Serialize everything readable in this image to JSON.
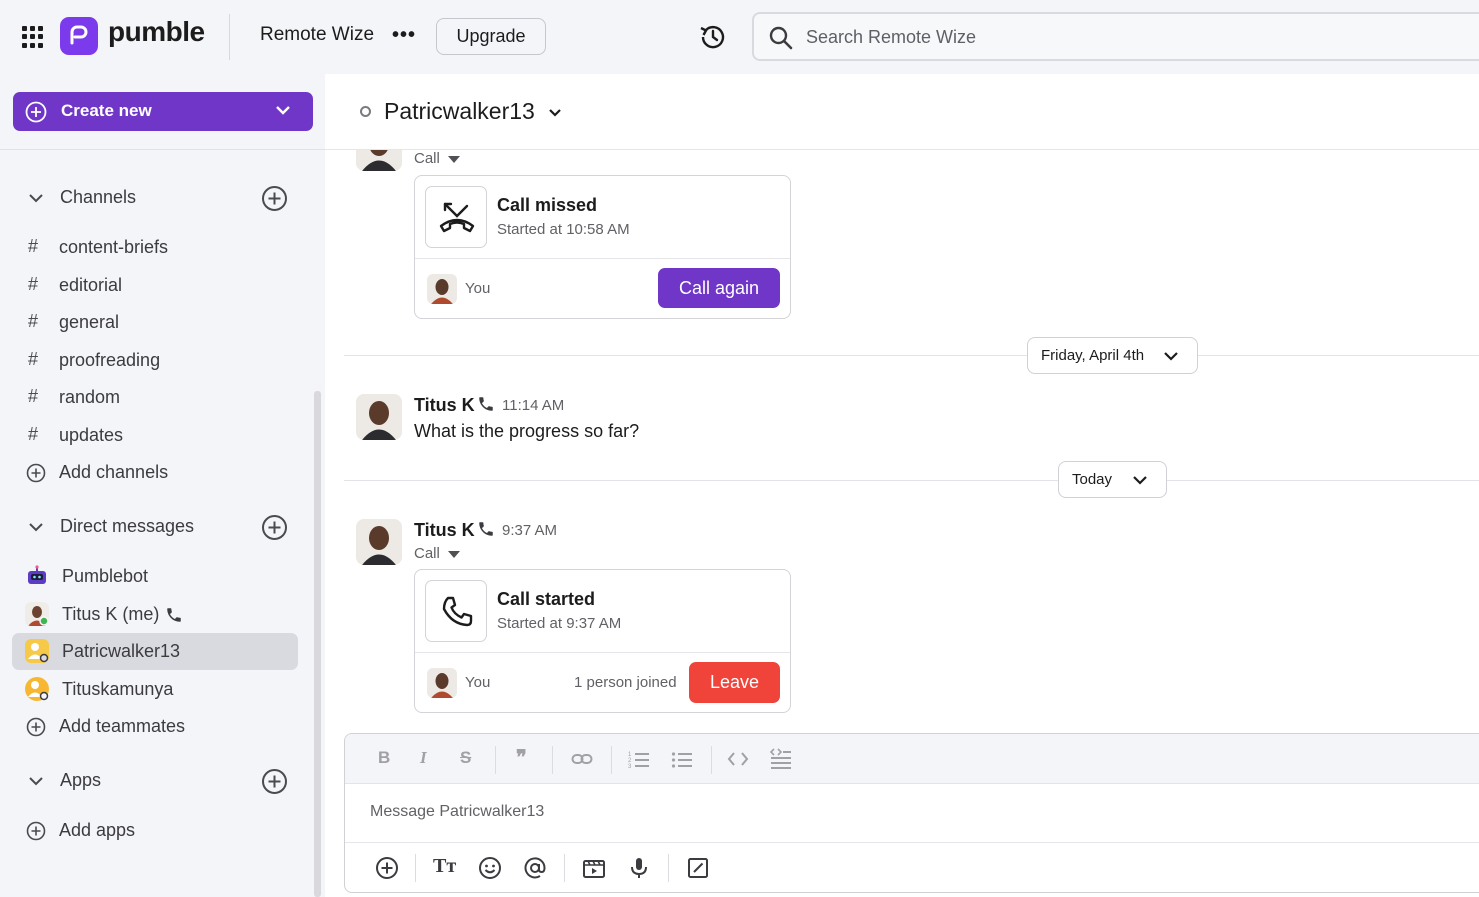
{
  "app": {
    "name": "pumble",
    "workspace": "Remote Wize",
    "upgrade_label": "Upgrade"
  },
  "search": {
    "placeholder": "Search Remote Wize"
  },
  "sidebar": {
    "create_new_label": "Create new",
    "channels_label": "Channels",
    "channels": [
      "content-briefs",
      "editorial",
      "general",
      "proofreading",
      "random",
      "updates"
    ],
    "add_channels_label": "Add channels",
    "dm_label": "Direct messages",
    "dms": [
      "Pumblebot",
      "Titus K (me)",
      "Patricwalker13",
      "Tituskamunya"
    ],
    "add_teammates_label": "Add teammates",
    "apps_label": "Apps",
    "add_apps_label": "Add apps"
  },
  "conversation": {
    "title": "Patricwalker13",
    "first_msg_sub": "Call",
    "missed_card": {
      "title": "Call missed",
      "subtitle": "Started at 10:58 AM",
      "you": "You",
      "button": "Call again"
    },
    "day1": "Friday, April 4th",
    "msg1": {
      "name": "Titus K",
      "time": "11:14 AM",
      "text": "What is the progress so far?"
    },
    "day2": "Today",
    "msg2": {
      "name": "Titus K",
      "time": "9:37 AM",
      "sub": "Call"
    },
    "started_card": {
      "title": "Call started",
      "subtitle": "Started at 9:37 AM",
      "you": "You",
      "joined": "1 person joined",
      "button": "Leave"
    }
  },
  "composer": {
    "placeholder": "Message Patricwalker13"
  },
  "colors": {
    "brand": "#6f36c7",
    "danger": "#f0433a"
  }
}
